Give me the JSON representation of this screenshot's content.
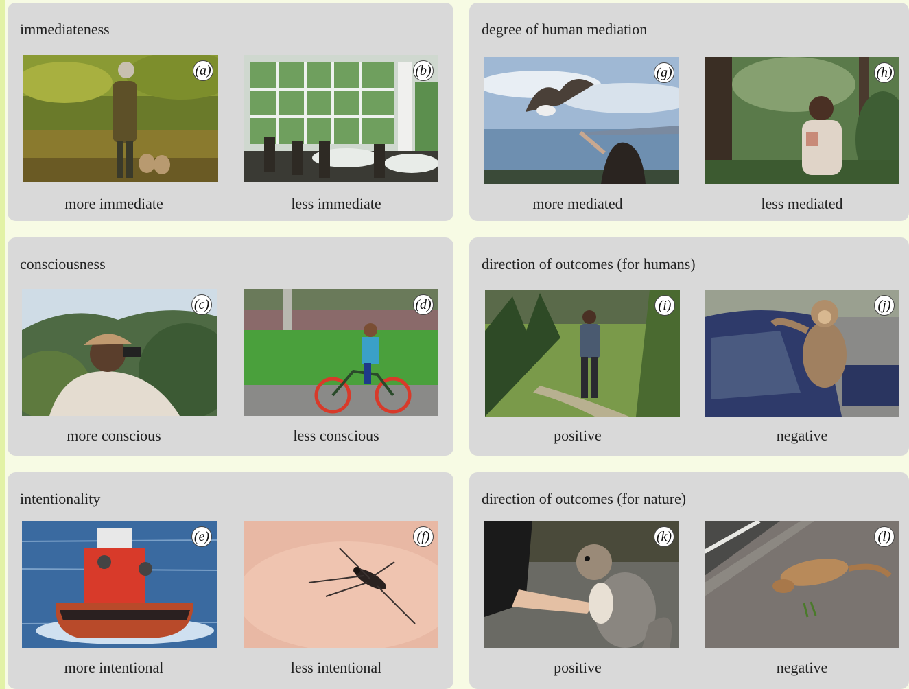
{
  "panels": [
    {
      "title": "immediateness",
      "items": [
        {
          "letter": "(a)",
          "caption": "more immediate"
        },
        {
          "letter": "(b)",
          "caption": "less immediate"
        }
      ]
    },
    {
      "title": "degree of human mediation",
      "items": [
        {
          "letter": "(g)",
          "caption": "more mediated"
        },
        {
          "letter": "(h)",
          "caption": "less mediated"
        }
      ]
    },
    {
      "title": "consciousness",
      "items": [
        {
          "letter": "(c)",
          "caption": "more conscious"
        },
        {
          "letter": "(d)",
          "caption": "less conscious"
        }
      ]
    },
    {
      "title": "direction of outcomes (for humans)",
      "items": [
        {
          "letter": "(i)",
          "caption": "positive"
        },
        {
          "letter": "(j)",
          "caption": "negative"
        }
      ]
    },
    {
      "title": "intentionality",
      "items": [
        {
          "letter": "(e)",
          "caption": "more intentional"
        },
        {
          "letter": "(f)",
          "caption": "less intentional"
        }
      ]
    },
    {
      "title": "direction of outcomes (for nature)",
      "items": [
        {
          "letter": "(k)",
          "caption": "positive"
        },
        {
          "letter": "(l)",
          "caption": "negative"
        }
      ]
    }
  ]
}
